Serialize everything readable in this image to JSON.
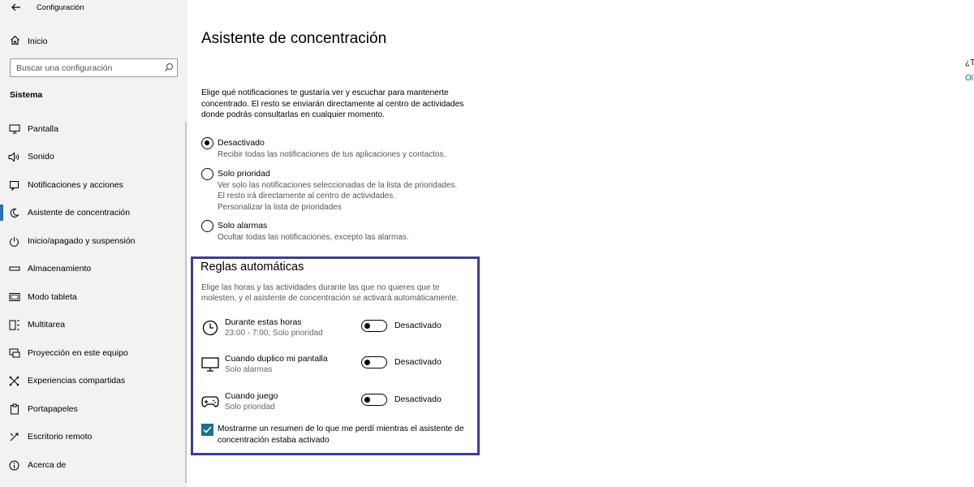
{
  "window": {
    "title": "Configuración"
  },
  "sidebar": {
    "home_label": "Inicio",
    "search_placeholder": "Buscar una configuración",
    "section_title": "Sistema",
    "items": [
      {
        "label": "Pantalla",
        "icon": "monitor-icon"
      },
      {
        "label": "Sonido",
        "icon": "speaker-icon"
      },
      {
        "label": "Notificaciones y acciones",
        "icon": "notification-icon"
      },
      {
        "label": "Asistente de concentración",
        "icon": "moon-icon",
        "selected": true
      },
      {
        "label": "Inicio/apagado y suspensión",
        "icon": "power-icon"
      },
      {
        "label": "Almacenamiento",
        "icon": "storage-icon"
      },
      {
        "label": "Modo tableta",
        "icon": "tablet-icon"
      },
      {
        "label": "Multitarea",
        "icon": "multitask-icon"
      },
      {
        "label": "Proyección en este equipo",
        "icon": "projection-icon"
      },
      {
        "label": "Experiencias compartidas",
        "icon": "shared-icon"
      },
      {
        "label": "Portapapeles",
        "icon": "clipboard-icon"
      },
      {
        "label": "Escritorio remoto",
        "icon": "remote-icon"
      },
      {
        "label": "Acerca de",
        "icon": "info-icon"
      }
    ]
  },
  "main": {
    "title": "Asistente de concentración",
    "intro": "Elige qué notificaciones te gustaría ver y escuchar para mantenerte concentrado. El resto se enviarán directamente al centro de actividades donde podrás consultarlas en cualquier momento.",
    "options": [
      {
        "label": "Desactivado",
        "desc": "Recibir todas las notificaciones de tus aplicaciones y contactos.",
        "selected": true
      },
      {
        "label": "Solo prioridad",
        "desc1": "Ver solo las notificaciones seleccionadas de la lista de prioridades.",
        "desc2": "El resto irá directamente al centro de actividades.",
        "link": "Personalizar la lista de prioridades",
        "selected": false
      },
      {
        "label": "Solo alarmas",
        "desc": "Ocultar todas las notificaciones, excepto las alarmas.",
        "selected": false
      }
    ],
    "rules": {
      "title": "Reglas automáticas",
      "desc": "Elige las horas y las actividades durante las que no quieres que te molesten, y el asistente de concentración se activará automáticamente.",
      "items": [
        {
          "name": "Durante estas horas",
          "sub": "23:00 - 7:00; Solo prioridad",
          "state": "Desactivado",
          "icon": "clock-icon"
        },
        {
          "name": "Cuando duplico mi pantalla",
          "sub": "Solo alarmas",
          "state": "Desactivado",
          "icon": "monitor-icon"
        },
        {
          "name": "Cuando juego",
          "sub": "Solo prioridad",
          "state": "Desactivado",
          "icon": "gamepad-icon"
        }
      ],
      "summary_checkbox": {
        "label": "Mostrarme un resumen de lo que me perdí mientras el asistente de concentración estaba activado",
        "checked": true
      }
    }
  },
  "right_panel": {
    "question": "¿T",
    "link": "Ol"
  },
  "colors": {
    "accent": "#2b6fb6",
    "checkbox": "#1f6f8b",
    "link": "#00668f",
    "highlight_border": "#3d3d9a"
  }
}
